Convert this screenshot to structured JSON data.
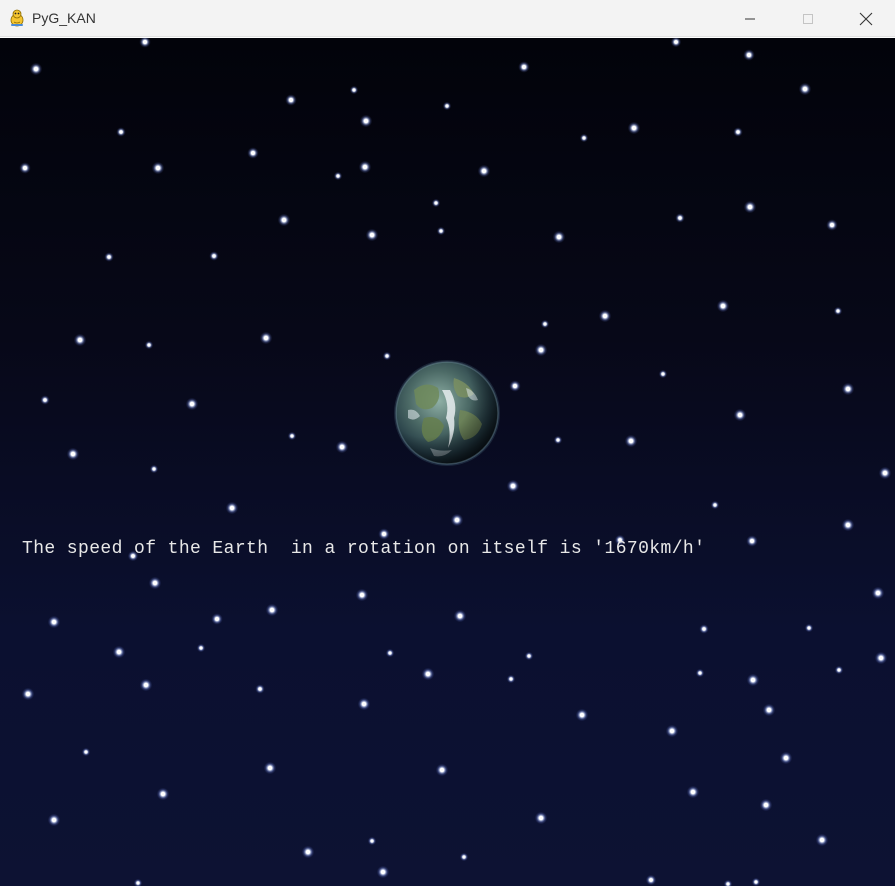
{
  "window": {
    "title": "PyG_KAN",
    "app_icon": "pygame-snake-icon",
    "controls": {
      "minimize_icon": "minimize-icon",
      "maximize_icon": "maximize-icon",
      "close_icon": "close-icon"
    }
  },
  "scene": {
    "background": "starfield",
    "planet": "earth",
    "message": "The speed of the Earth  in a rotation on itself is '1670km/h'"
  },
  "colors": {
    "sky_top": "#02030a",
    "sky_bottom": "#0d1233",
    "star": "#ffffff",
    "text": "#e8e8e8",
    "titlebar": "#f3f3f3"
  }
}
